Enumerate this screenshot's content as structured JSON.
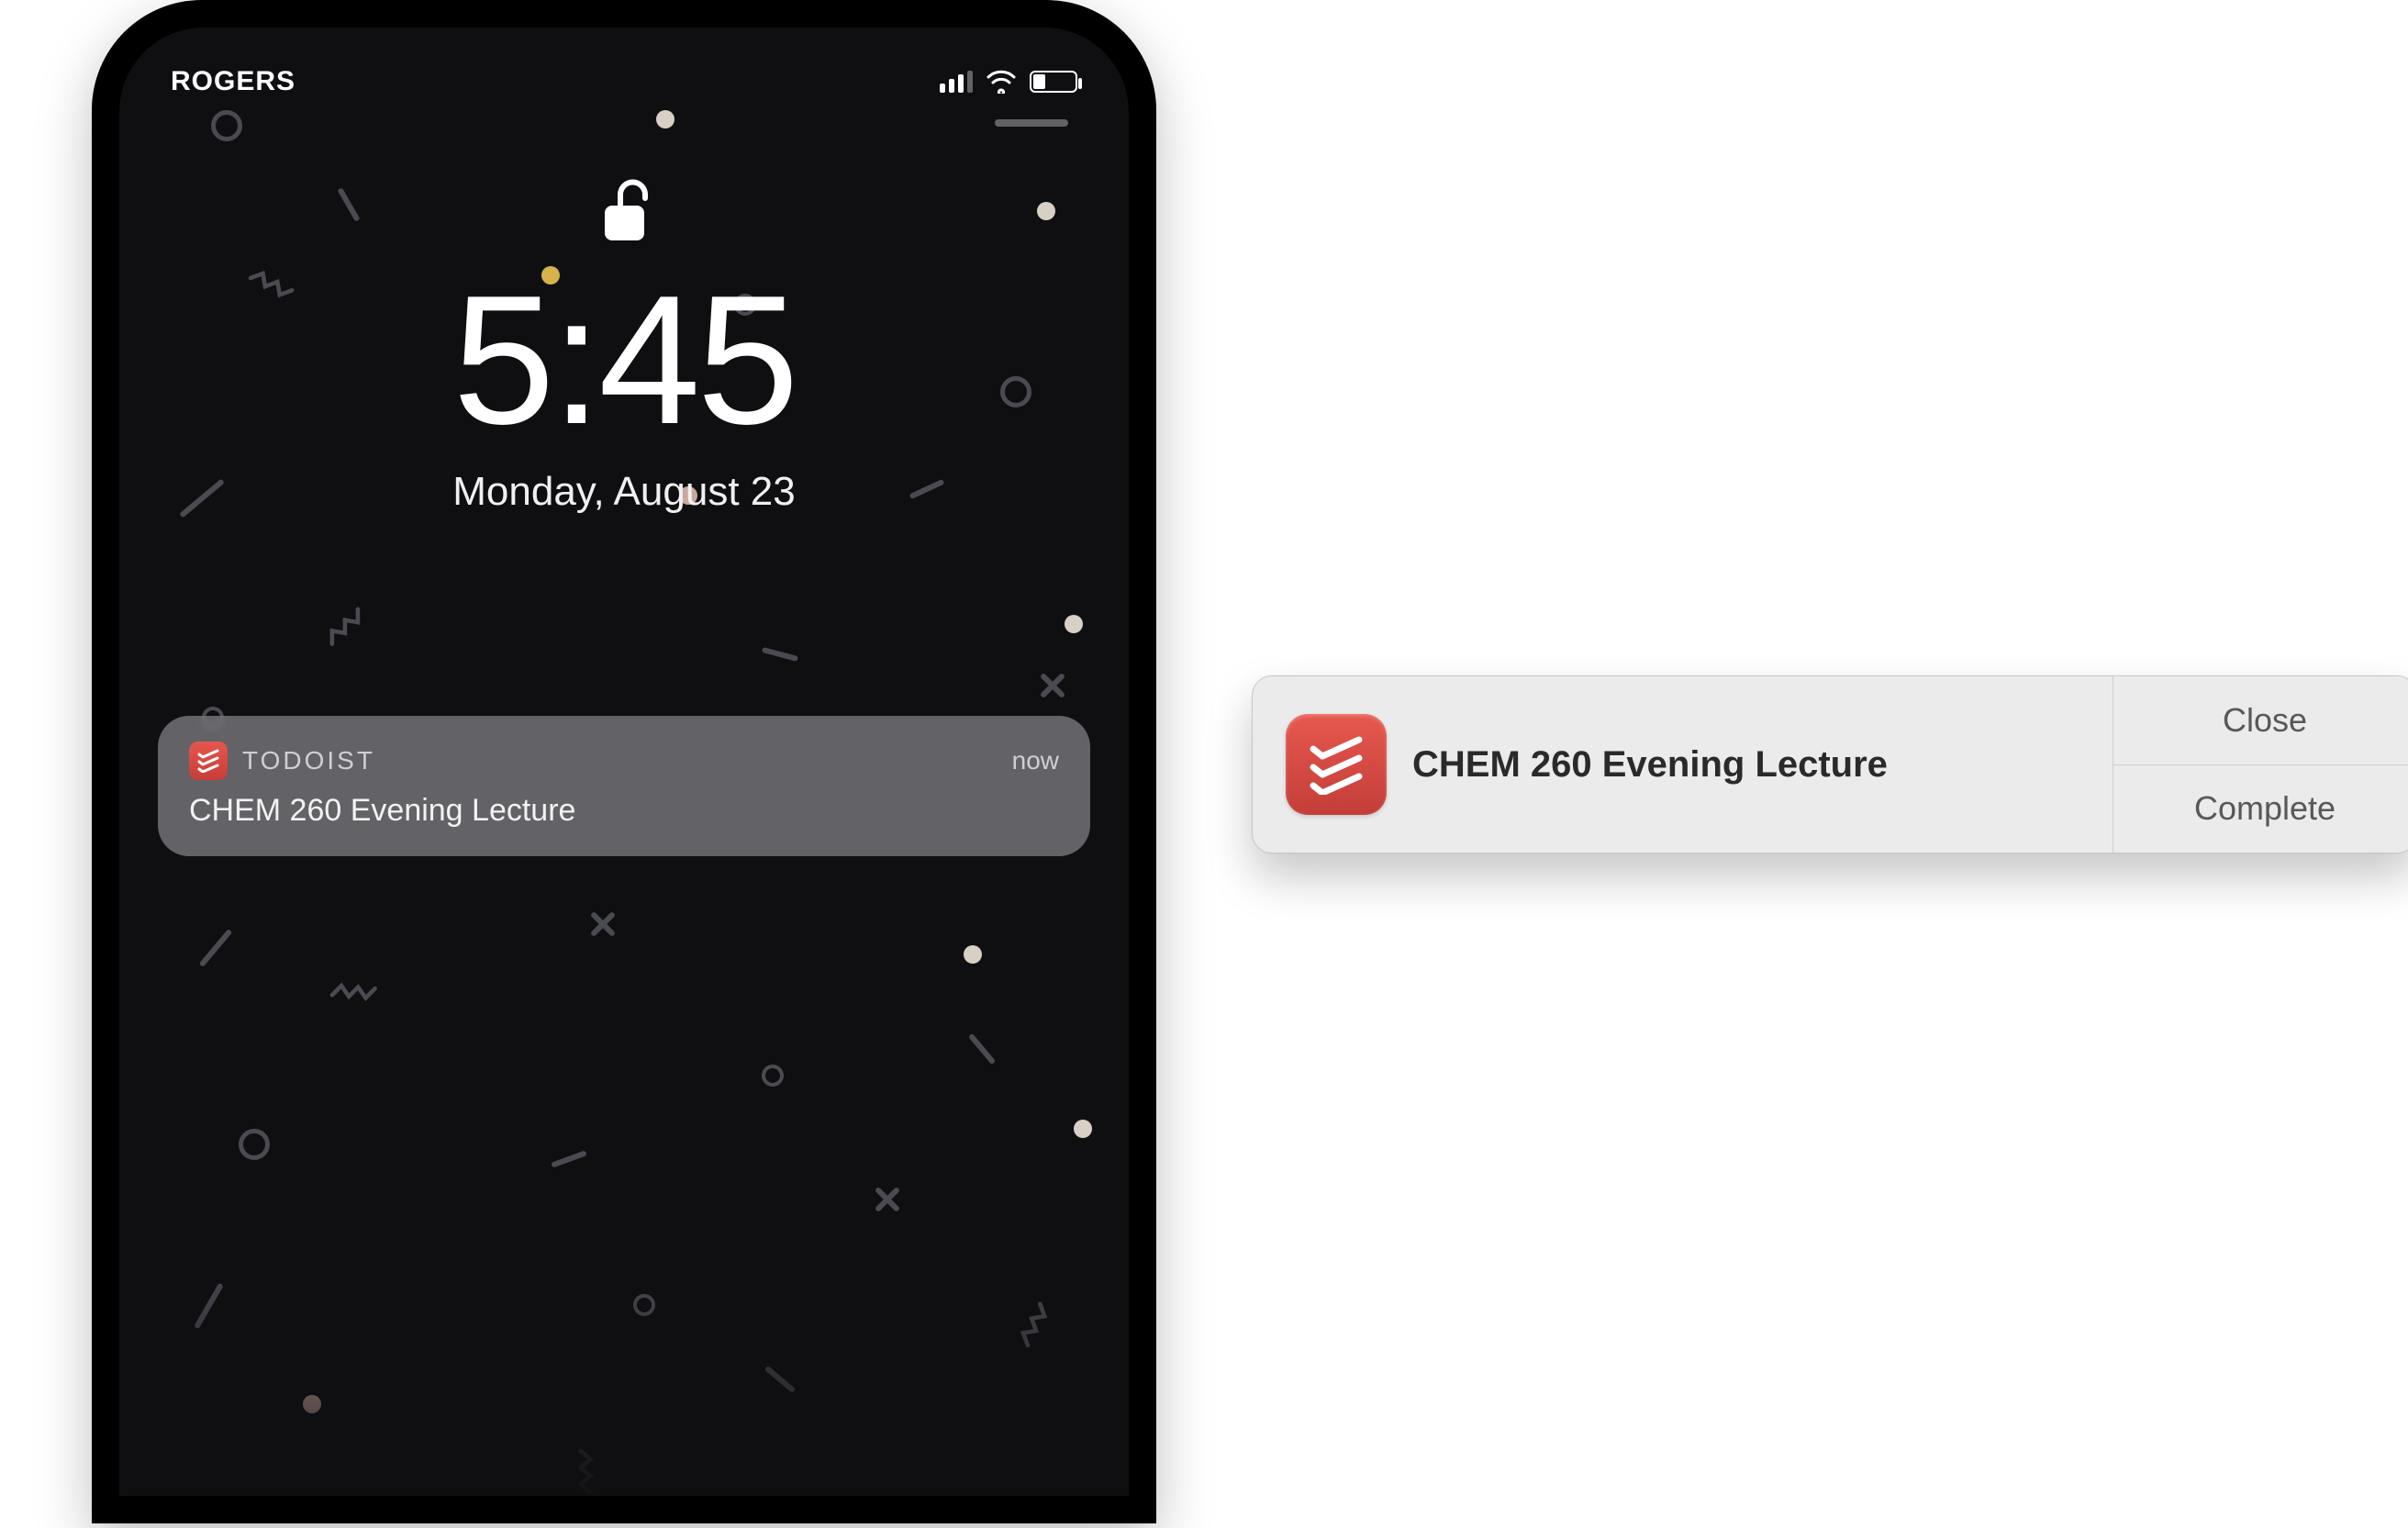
{
  "phone": {
    "carrier": "ROGERS",
    "time": "5:45",
    "date": "Monday, August 23",
    "notification": {
      "app_name": "TODOIST",
      "timestamp": "now",
      "body": "CHEM 260 Evening Lecture"
    }
  },
  "desktop_notification": {
    "title": "CHEM 260 Evening Lecture",
    "close_label": "Close",
    "complete_label": "Complete"
  }
}
